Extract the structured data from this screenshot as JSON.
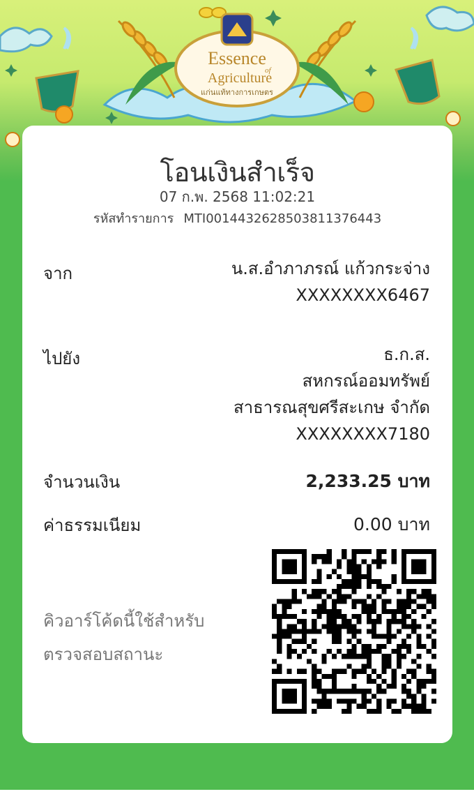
{
  "banner": {
    "logo_title_line1": "Essence",
    "logo_title_of": "of",
    "logo_title_line2": "Agriculture",
    "logo_subtitle": "แก่นแท้ทางการเกษตร"
  },
  "receipt": {
    "title": "โอนเงินสำเร็จ",
    "datetime": "07 ก.พ. 2568 11:02:21",
    "ref_label": "รหัสทำรายการ",
    "ref_value": "MTI0014432628503811376443",
    "from": {
      "label": "จาก",
      "name": "น.ส.อำภาภรณ์ แก้วกระจ่าง",
      "account": "XXXXXXXX6467"
    },
    "to": {
      "label": "ไปยัง",
      "bank": "ธ.ก.ส.",
      "name_line1": "สหกรณ์ออมทรัพย์",
      "name_line2": "สาธารณสุขศรีสะเกษ จำกัด",
      "account": "XXXXXXXX7180"
    },
    "amount": {
      "label": "จำนวนเงิน",
      "value": "2,233.25 บาท"
    },
    "fee": {
      "label": "ค่าธรรมเนียม",
      "value": "0.00 บาท"
    },
    "qr_note_line1": "คิวอาร์โค้ดนี้ใช้สำหรับ",
    "qr_note_line2": "ตรวจสอบสถานะ"
  },
  "colors": {
    "background_green": "#4fbb4f",
    "card": "#ffffff",
    "banner_top": "#d8f07a"
  }
}
